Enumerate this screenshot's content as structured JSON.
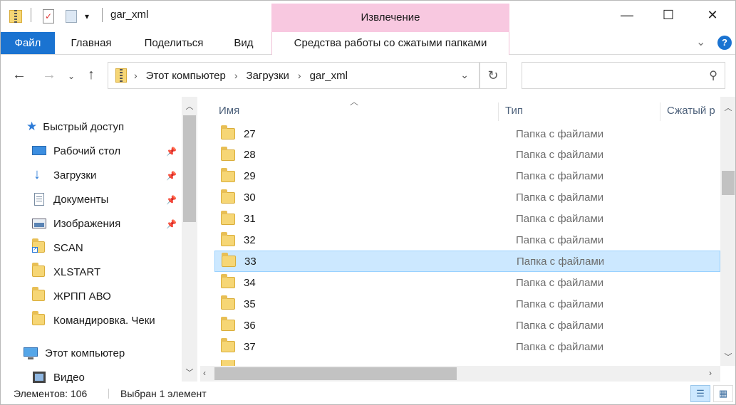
{
  "window": {
    "title": "gar_xml",
    "context_tab_header": "Извлечение",
    "buttons": {
      "minimize": "—",
      "maximize": "☐",
      "close": "✕"
    }
  },
  "ribbon": {
    "tabs": [
      "Файл",
      "Главная",
      "Поделиться",
      "Вид",
      "Средства работы со сжатыми папками"
    ],
    "help": "?",
    "collapse": "⌄"
  },
  "address": {
    "crumbs": [
      "Этот компьютер",
      "Загрузки",
      "gar_xml"
    ],
    "search_placeholder": ""
  },
  "nav": {
    "quick_access": "Быстрый доступ",
    "items": [
      {
        "label": "Рабочий стол",
        "icon": "desktop-icon",
        "pinned": true
      },
      {
        "label": "Загрузки",
        "icon": "download-arrow-icon",
        "pinned": true
      },
      {
        "label": "Документы",
        "icon": "documents-icon",
        "pinned": true
      },
      {
        "label": "Изображения",
        "icon": "pictures-icon",
        "pinned": true
      },
      {
        "label": "SCAN",
        "icon": "folder-shortcut-icon",
        "pinned": false
      },
      {
        "label": "XLSTART",
        "icon": "folder-icon",
        "pinned": false
      },
      {
        "label": "ЖРПП АВО",
        "icon": "folder-icon",
        "pinned": false
      },
      {
        "label": "Командировка. Чеки",
        "icon": "folder-icon",
        "pinned": false
      }
    ],
    "this_pc": "Этот компьютер",
    "video": "Видео"
  },
  "list": {
    "columns": {
      "name": "Имя",
      "type": "Тип",
      "compressed": "Сжатый р"
    },
    "rows": [
      {
        "name": "27",
        "type": "Папка с файлами",
        "selected": false
      },
      {
        "name": "28",
        "type": "Папка с файлами",
        "selected": false
      },
      {
        "name": "29",
        "type": "Папка с файлами",
        "selected": false
      },
      {
        "name": "30",
        "type": "Папка с файлами",
        "selected": false
      },
      {
        "name": "31",
        "type": "Папка с файлами",
        "selected": false
      },
      {
        "name": "32",
        "type": "Папка с файлами",
        "selected": false
      },
      {
        "name": "33",
        "type": "Папка с файлами",
        "selected": true
      },
      {
        "name": "34",
        "type": "Папка с файлами",
        "selected": false
      },
      {
        "name": "35",
        "type": "Папка с файлами",
        "selected": false
      },
      {
        "name": "36",
        "type": "Папка с файлами",
        "selected": false
      },
      {
        "name": "37",
        "type": "Папка с файлами",
        "selected": false
      }
    ]
  },
  "status": {
    "count": "Элементов: 106",
    "selection": "Выбран 1 элемент"
  },
  "colors": {
    "file_tab": "#1a73d1",
    "context_tab": "#f8c8e0",
    "selection": "#cce8ff",
    "help": "#1a73d1"
  }
}
